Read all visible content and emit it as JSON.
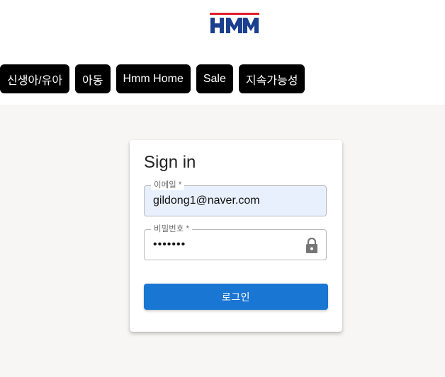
{
  "header": {
    "logo_text": "HMM",
    "logo_colors": {
      "blue": "#1b3f8f",
      "red": "#e21d2b"
    },
    "nav": [
      {
        "label": "신생아/유아"
      },
      {
        "label": "아동"
      },
      {
        "label": "Hmm Home"
      },
      {
        "label": "Sale"
      },
      {
        "label": "지속가능성"
      }
    ]
  },
  "signin": {
    "title": "Sign in",
    "email": {
      "label": "이메일 *",
      "value": "gildong1@naver.com"
    },
    "password": {
      "label": "비밀번호 *",
      "value": "1234567",
      "icon": "lock-icon"
    },
    "submit_label": "로그인"
  },
  "colors": {
    "nav_background": "#000000",
    "primary": "#1976d2",
    "main_background": "#f7f6f4",
    "autofill_background": "#e8f0fe"
  }
}
